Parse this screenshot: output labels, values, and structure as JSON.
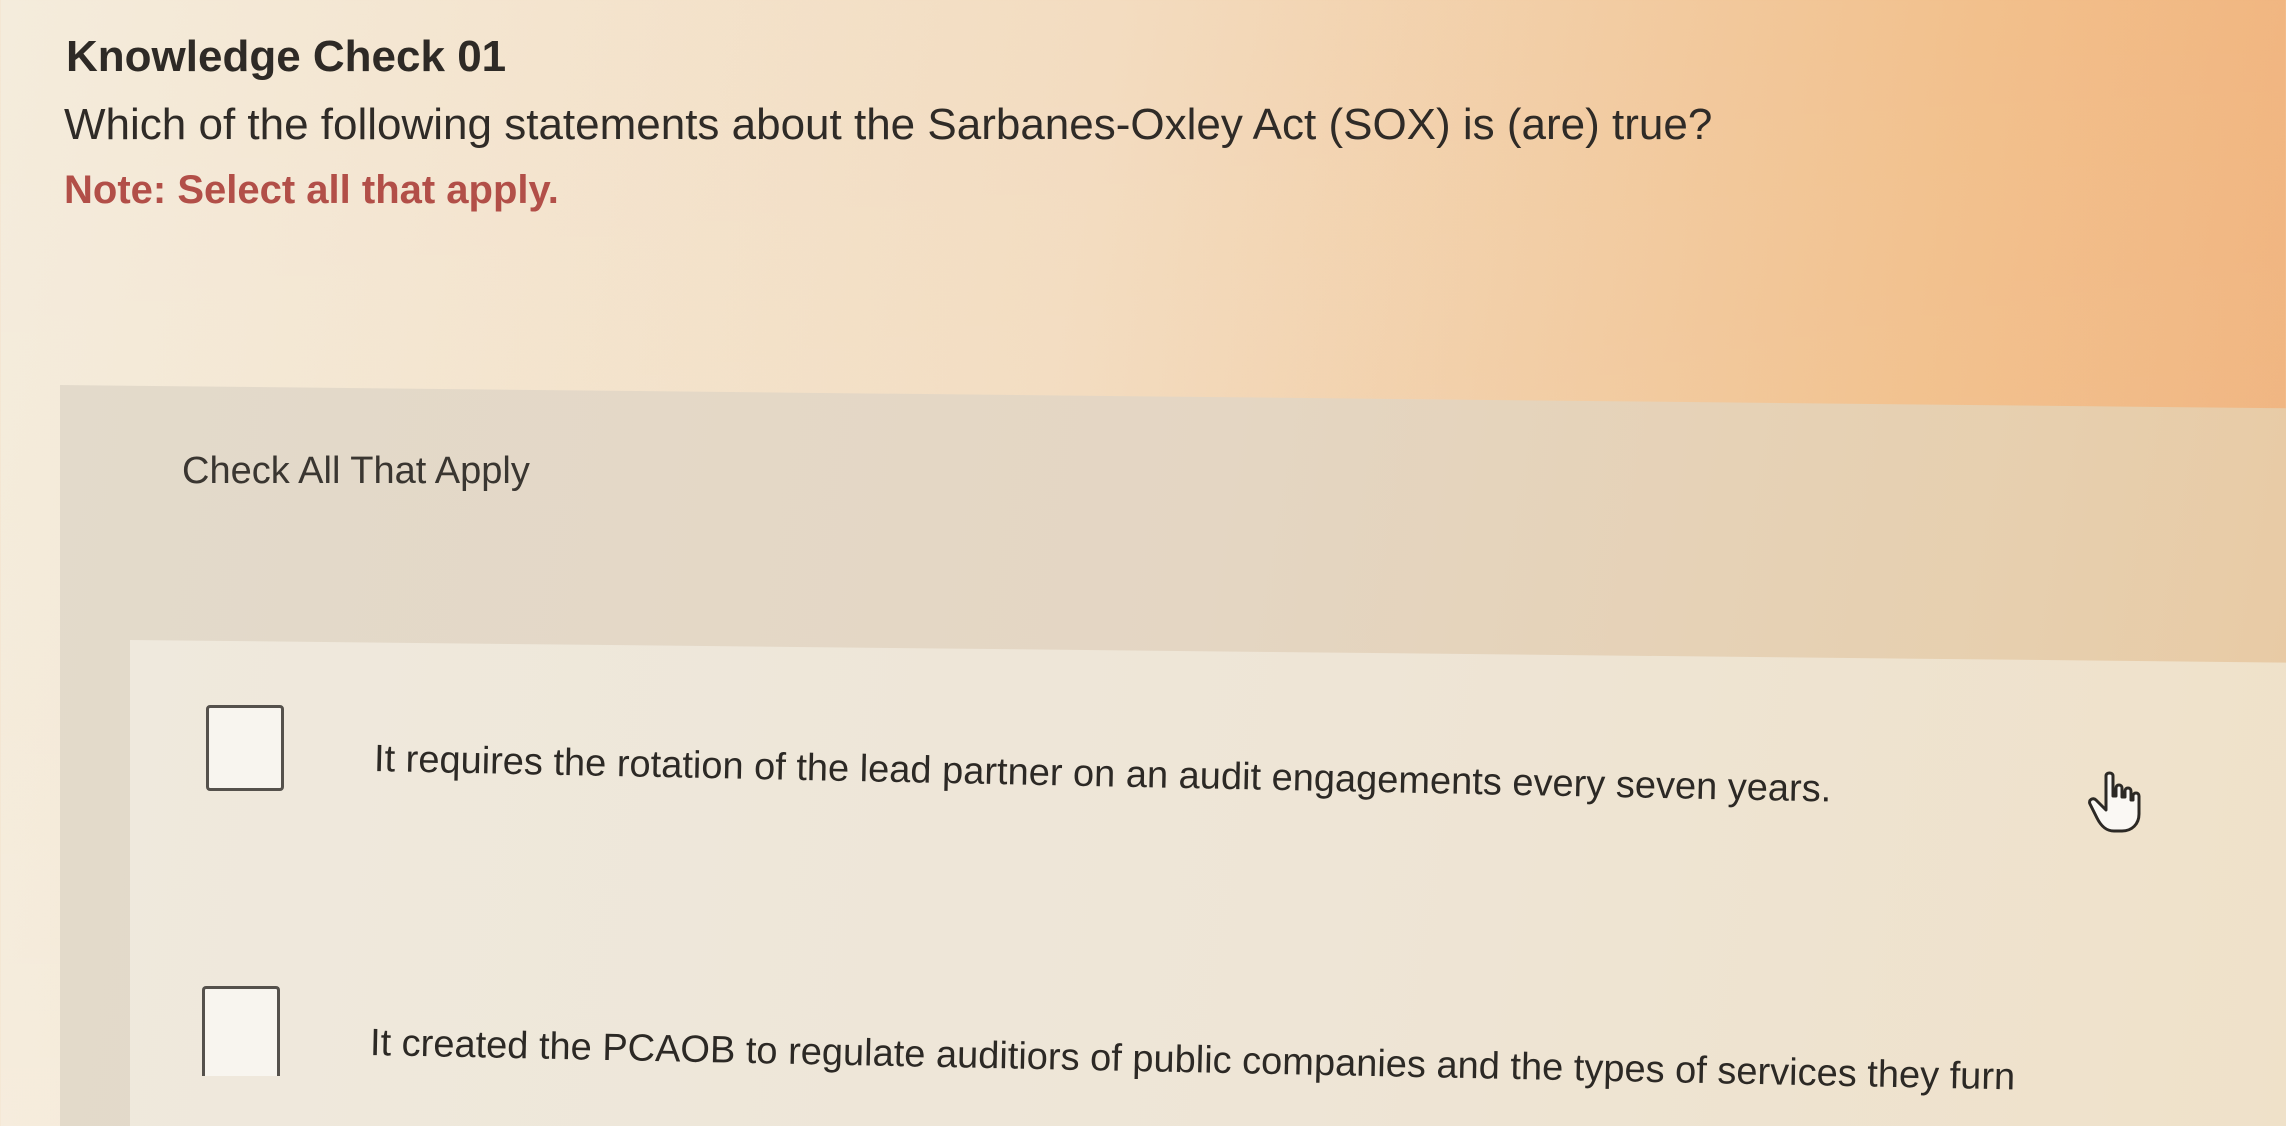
{
  "header": {
    "title": "Knowledge Check 01",
    "question": "Which of the following statements about the Sarbanes-Oxley Act (SOX) is (are) true?",
    "note": "Note: Select all that apply."
  },
  "panel": {
    "label": "Check All That Apply",
    "options": [
      {
        "text": "It requires the rotation of the lead partner on an audit engagements every seven years.",
        "checked": false
      },
      {
        "text": "It created the PCAOB to regulate auditiors of public companies and the types of services they furn",
        "checked": false
      }
    ]
  },
  "cursor": {
    "icon": "hand-pointer-icon"
  },
  "colors": {
    "note": "#b24f48",
    "text": "#2e2a26"
  }
}
